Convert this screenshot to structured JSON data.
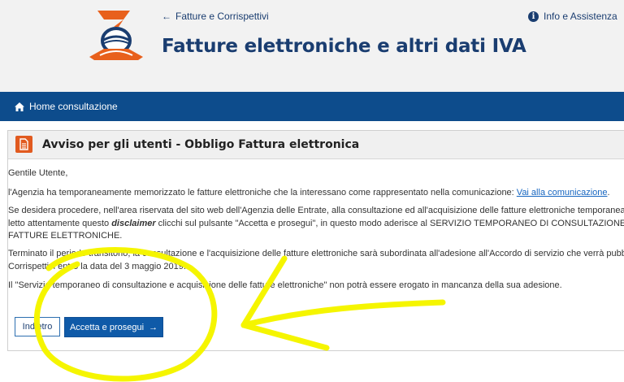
{
  "header": {
    "back_link": "Fatture e Corrispettivi",
    "help_link": "Info e Assistenza",
    "title": "Fatture elettroniche e altri dati IVA"
  },
  "nav": {
    "home": "Home consultazione"
  },
  "notice": {
    "title": "Avviso per gli utenti - Obbligo Fattura elettronica",
    "greeting": "Gentile Utente,",
    "p1_text": "l'Agenzia ha temporaneamente memorizzato le fatture elettroniche che la interessano come rappresentato nella comunicazione: ",
    "p1_link": "Vai alla comunicazione",
    "p1_end": ".",
    "p2_line1": "Se desidera procedere, nell'area riservata del sito web dell'Agenzia delle Entrate, alla consultazione ed all'acquisizione delle fatture elettroniche temporanear",
    "p2_line2a": "letto attentamente questo ",
    "p2_emph": "disclaimer",
    "p2_line2b": " clicchi sul pulsante \"Accetta e prosegui\", in questo modo aderisce al SERVIZIO TEMPORANEO DI CONSULTAZIONE E",
    "p2_line3": "FATTURE ELETTRONICHE.",
    "p3_line1": "Terminato il periodo transitorio, la consultazione e l'acquisizione delle fatture elettroniche sarà subordinata all'adesione all'Accordo di servizio che verrà pubbl",
    "p3_line2": "Corrispettivi entro la data del 3 maggio 2019.",
    "p4": "Il \"Servizio temporaneo di consultazione e acquisizione delle fatture elettroniche\" non potrà essere erogato in mancanza della sua adesione."
  },
  "buttons": {
    "back": "Indietro",
    "accept": "Accetta e prosegui"
  },
  "colors": {
    "brand_blue": "#1a3d70",
    "nav_blue": "#0d4c8c",
    "accent_orange": "#e15a1f",
    "highlight_yellow": "#f5f500"
  }
}
